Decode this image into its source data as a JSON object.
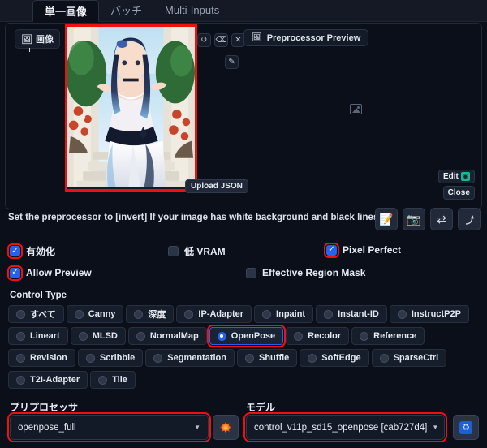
{
  "tabs": [
    {
      "label": "単一画像",
      "active": true
    },
    {
      "label": "バッチ",
      "active": false
    },
    {
      "label": "Multi-Inputs",
      "active": false
    }
  ],
  "image_panel": {
    "image_tab_label": "画像",
    "image_tab_icon": "image-icon",
    "upload_json_label": "Upload JSON",
    "preprocessor_preview_label": "Preprocessor Preview",
    "preprocessor_preview_icon": "image-icon",
    "tool_icons": [
      "undo-icon",
      "eraser-icon",
      "close-icon",
      "brush-icon"
    ],
    "placeholder_icon": "image-placeholder-icon",
    "edit_label": "Edit",
    "edit_icon": "openpose-editor-icon",
    "close_label": "Close",
    "annotation_color": "#ee1111",
    "thumbnail_alt": "anime character in white dress standing on garden stairs"
  },
  "hint": {
    "text": "Set the preprocessor to [invert] If your image has white background and black lines.",
    "buttons": [
      {
        "icon": "note-edit-icon",
        "glyph": "📝"
      },
      {
        "icon": "camera-icon",
        "glyph": "📷"
      },
      {
        "icon": "swap-arrows-icon",
        "glyph": "⇄"
      },
      {
        "icon": "curve-icon",
        "glyph": "⌁"
      }
    ]
  },
  "checkboxes": [
    {
      "label": "有効化",
      "checked": true,
      "highlighted": true,
      "name": "enable"
    },
    {
      "label": "低 VRAM",
      "checked": false,
      "highlighted": false,
      "name": "low-vram"
    },
    {
      "label": "Pixel Perfect",
      "checked": true,
      "highlighted": true,
      "name": "pixel-perfect"
    },
    {
      "label": "Allow Preview",
      "checked": true,
      "highlighted": true,
      "name": "allow-preview"
    },
    {
      "label": "Effective Region Mask",
      "checked": false,
      "highlighted": false,
      "name": "effective-region-mask"
    }
  ],
  "control_type": {
    "title": "Control Type",
    "selected": "OpenPose",
    "rows": [
      [
        "すべて",
        "Canny",
        "深度",
        "IP-Adapter",
        "Inpaint",
        "Instant-ID",
        "InstructP2P"
      ],
      [
        "Lineart",
        "MLSD",
        "NormalMap",
        "OpenPose",
        "Recolor",
        "Reference"
      ],
      [
        "Revision",
        "Scribble",
        "Segmentation",
        "Shuffle",
        "SoftEdge",
        "SparseCtrl"
      ],
      [
        "T2I-Adapter",
        "Tile"
      ]
    ]
  },
  "preprocessor": {
    "label": "プリプロセッサ",
    "value": "openpose_full",
    "caret": "▼",
    "run_icon": "explosion-icon"
  },
  "model": {
    "label": "モデル",
    "value": "control_v11p_sd15_openpose [cab727d4]",
    "caret": "▼",
    "refresh_icon": "refresh-icon"
  },
  "colors": {
    "background": "#0b0f19",
    "accent_blue": "#2563eb",
    "annotation_red": "#ee1111",
    "panel": "#141925"
  }
}
